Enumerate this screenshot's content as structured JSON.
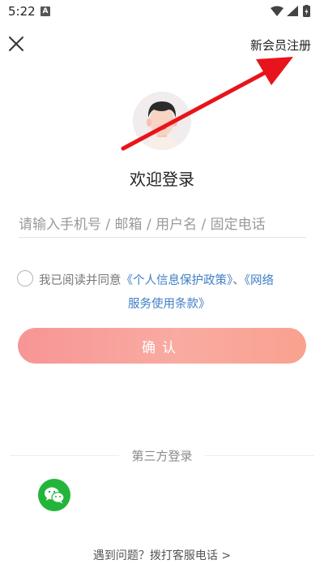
{
  "status_bar": {
    "time": "5:22",
    "icons": [
      "notification-a-icon",
      "wifi-icon",
      "signal-icon",
      "battery-icon"
    ]
  },
  "header": {
    "close_icon": "close-icon",
    "register_label": "新会员注册"
  },
  "avatar": {
    "icon": "avatar-icon"
  },
  "title": "欢迎登录",
  "account_input": {
    "value": "",
    "placeholder": "请输入手机号 / 邮箱 / 用户名 / 固定电话"
  },
  "agreement": {
    "prefix": "我已阅读并同意",
    "privacy_link": "《个人信息保护政策》",
    "separator": "、",
    "terms_link_part1": "《网络",
    "terms_link_part2": "服务使用条款》",
    "checked": false
  },
  "confirm_label": "确认",
  "third_party": {
    "label": "第三方登录",
    "providers": [
      "wechat-icon"
    ]
  },
  "help_label": "遇到问题？拨打客服电话 >",
  "colors": {
    "accent_gradient_start": "#f79595",
    "accent_gradient_end": "#f9a18f",
    "link": "#3f7ec5",
    "wechat": "#22b53a",
    "annotation_arrow": "#e8141b"
  }
}
